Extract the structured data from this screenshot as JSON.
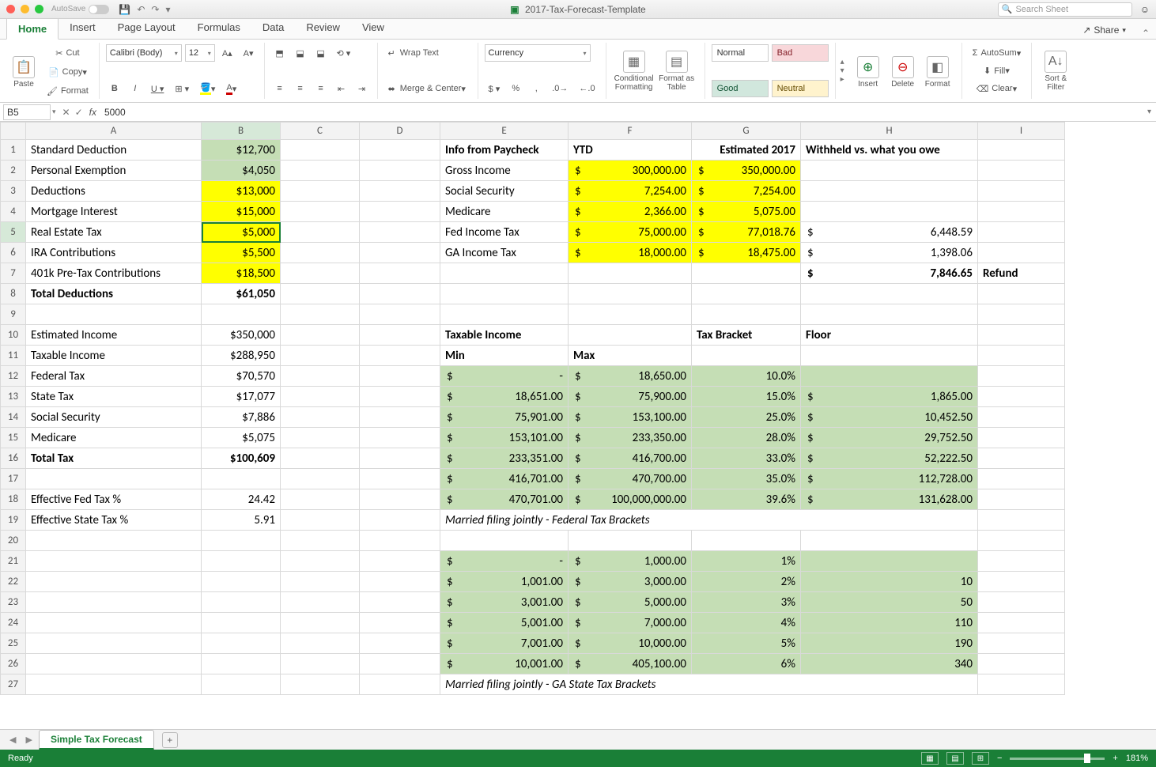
{
  "app": {
    "title": "2017-Tax-Forecast-Template",
    "search_placeholder": "Search Sheet",
    "autosave": "AutoSave"
  },
  "tabs": [
    "Home",
    "Insert",
    "Page Layout",
    "Formulas",
    "Data",
    "Review",
    "View"
  ],
  "share": "Share",
  "ribbon": {
    "paste": "Paste",
    "cut": "Cut",
    "copy": "Copy",
    "format": "Format",
    "font": "Calibri (Body)",
    "size": "12",
    "wrap": "Wrap Text",
    "merge": "Merge & Center",
    "numfmt": "Currency",
    "cond": "Conditional Formatting",
    "table": "Format as Table",
    "styles": {
      "normal": "Normal",
      "bad": "Bad",
      "good": "Good",
      "neutral": "Neutral"
    },
    "insert": "Insert",
    "delete": "Delete",
    "formatcell": "Format",
    "autosum": "AutoSum",
    "fill": "Fill",
    "clear": "Clear",
    "sort": "Sort & Filter"
  },
  "namebox": "B5",
  "formula": "5000",
  "cols": [
    "A",
    "B",
    "C",
    "D",
    "E",
    "F",
    "G",
    "H",
    "I"
  ],
  "rows": [
    {
      "n": 1,
      "A": "Standard Deduction",
      "B": "$12,700",
      "Bcls": "hlGreen r",
      "E": "Info from Paycheck",
      "Ecls": "b",
      "F": "YTD",
      "Fcls": "b l",
      "G": "Estimated 2017",
      "Gcls": "b r",
      "H": "Withheld vs. what you owe",
      "Hcls": "b l"
    },
    {
      "n": 2,
      "A": "Personal Exemption",
      "B": "$4,050",
      "Bcls": "hlGreen r",
      "E": "Gross Income",
      "F": {
        "sym": "$",
        "val": "300,000.00"
      },
      "Fcls": "hlYellow",
      "G": {
        "sym": "$",
        "val": "350,000.00"
      },
      "Gcls": "hlYellow"
    },
    {
      "n": 3,
      "A": "Deductions",
      "B": "$13,000",
      "Bcls": "hlYellow r",
      "E": "Social Security",
      "F": {
        "sym": "$",
        "val": "7,254.00"
      },
      "Fcls": "hlYellow",
      "G": {
        "sym": "$",
        "val": "7,254.00"
      },
      "Gcls": "hlYellow"
    },
    {
      "n": 4,
      "A": "Mortgage Interest",
      "B": "$15,000",
      "Bcls": "hlYellow r",
      "E": "Medicare",
      "F": {
        "sym": "$",
        "val": "2,366.00"
      },
      "Fcls": "hlYellow",
      "G": {
        "sym": "$",
        "val": "5,075.00"
      },
      "Gcls": "hlYellow"
    },
    {
      "n": 5,
      "A": "Real Estate Tax",
      "B": "$5,000",
      "Bcls": "hlYellow r activecell",
      "E": "Fed Income Tax",
      "F": {
        "sym": "$",
        "val": "75,000.00"
      },
      "Fcls": "hlYellow",
      "G": {
        "sym": "$",
        "val": "77,018.76"
      },
      "Gcls": "hlYellow",
      "H": {
        "sym": "$",
        "val": "6,448.59"
      }
    },
    {
      "n": 6,
      "A": "IRA Contributions",
      "B": "$5,500",
      "Bcls": "hlYellow r",
      "E": "GA Income Tax",
      "F": {
        "sym": "$",
        "val": "18,000.00"
      },
      "Fcls": "hlYellow",
      "G": {
        "sym": "$",
        "val": "18,475.00"
      },
      "Gcls": "hlYellow",
      "H": {
        "sym": "$",
        "val": "1,398.06"
      }
    },
    {
      "n": 7,
      "A": "401k Pre-Tax Contributions",
      "B": "$18,500",
      "Bcls": "hlYellow r",
      "H": {
        "sym": "$",
        "val": "7,846.65"
      },
      "Hcls": "b",
      "I": "Refund",
      "Icls": "b l"
    },
    {
      "n": 8,
      "A": "Total Deductions",
      "Acls": "b",
      "B": "$61,050",
      "Bcls": "b r"
    },
    {
      "n": 9
    },
    {
      "n": 10,
      "A": "Estimated Income",
      "B": "$350,000",
      "Bcls": "r",
      "E": "Taxable Income",
      "Ecls": "b",
      "G": "Tax Bracket",
      "Gcls": "b l",
      "H": "Floor",
      "Hcls": "b l"
    },
    {
      "n": 11,
      "A": "Taxable Income",
      "B": "$288,950",
      "Bcls": "r",
      "E": "Min",
      "Ecls": "b",
      "F": "Max",
      "Fcls": "b l"
    },
    {
      "n": 12,
      "A": "Federal Tax",
      "B": "$70,570",
      "Bcls": "r",
      "E": {
        "sym": "$",
        "val": "-"
      },
      "Ecls": "hlSage",
      "F": {
        "sym": "$",
        "val": "18,650.00"
      },
      "Fcls": "hlSage",
      "G": "10.0%",
      "Gcls": "hlSage r",
      "Hcls": "hlSage"
    },
    {
      "n": 13,
      "A": "State Tax",
      "B": "$17,077",
      "Bcls": "r",
      "E": {
        "sym": "$",
        "val": "18,651.00"
      },
      "Ecls": "hlSage",
      "F": {
        "sym": "$",
        "val": "75,900.00"
      },
      "Fcls": "hlSage",
      "G": "15.0%",
      "Gcls": "hlSage r",
      "H": {
        "sym": "$",
        "val": "1,865.00"
      },
      "Hcls": "hlSage"
    },
    {
      "n": 14,
      "A": "Social Security",
      "B": "$7,886",
      "Bcls": "r",
      "E": {
        "sym": "$",
        "val": "75,901.00"
      },
      "Ecls": "hlSage",
      "F": {
        "sym": "$",
        "val": "153,100.00"
      },
      "Fcls": "hlSage",
      "G": "25.0%",
      "Gcls": "hlSage r",
      "H": {
        "sym": "$",
        "val": "10,452.50"
      },
      "Hcls": "hlSage"
    },
    {
      "n": 15,
      "A": "Medicare",
      "B": "$5,075",
      "Bcls": "r",
      "E": {
        "sym": "$",
        "val": "153,101.00"
      },
      "Ecls": "hlSage",
      "F": {
        "sym": "$",
        "val": "233,350.00"
      },
      "Fcls": "hlSage",
      "G": "28.0%",
      "Gcls": "hlSage r",
      "H": {
        "sym": "$",
        "val": "29,752.50"
      },
      "Hcls": "hlSage"
    },
    {
      "n": 16,
      "A": "Total Tax",
      "Acls": "b",
      "B": "$100,609",
      "Bcls": "b r",
      "E": {
        "sym": "$",
        "val": "233,351.00"
      },
      "Ecls": "hlSage",
      "F": {
        "sym": "$",
        "val": "416,700.00"
      },
      "Fcls": "hlSage",
      "G": "33.0%",
      "Gcls": "hlSage r",
      "H": {
        "sym": "$",
        "val": "52,222.50"
      },
      "Hcls": "hlSage"
    },
    {
      "n": 17,
      "E": {
        "sym": "$",
        "val": "416,701.00"
      },
      "Ecls": "hlSage",
      "F": {
        "sym": "$",
        "val": "470,700.00"
      },
      "Fcls": "hlSage",
      "G": "35.0%",
      "Gcls": "hlSage r",
      "H": {
        "sym": "$",
        "val": "112,728.00"
      },
      "Hcls": "hlSage"
    },
    {
      "n": 18,
      "A": "Effective Fed Tax %",
      "B": "24.42",
      "Bcls": "r",
      "E": {
        "sym": "$",
        "val": "470,701.00"
      },
      "Ecls": "hlSage",
      "F": {
        "sym": "$",
        "val": "100,000,000.00"
      },
      "Fcls": "hlSage",
      "G": "39.6%",
      "Gcls": "hlSage r",
      "H": {
        "sym": "$",
        "val": "131,628.00"
      },
      "Hcls": "hlSage"
    },
    {
      "n": 19,
      "A": "Effective State Tax %",
      "B": "5.91",
      "Bcls": "r",
      "E": "Married filing jointly - Federal Tax Brackets",
      "Ecls": "i",
      "Espan": 4
    },
    {
      "n": 20
    },
    {
      "n": 21,
      "E": {
        "sym": "$",
        "val": "-"
      },
      "Ecls": "hlSage",
      "F": {
        "sym": "$",
        "val": "1,000.00"
      },
      "Fcls": "hlSage",
      "G": "1%",
      "Gcls": "hlSage r",
      "Hcls": "hlSage"
    },
    {
      "n": 22,
      "E": {
        "sym": "$",
        "val": "1,001.00"
      },
      "Ecls": "hlSage",
      "F": {
        "sym": "$",
        "val": "3,000.00"
      },
      "Fcls": "hlSage",
      "G": "2%",
      "Gcls": "hlSage r",
      "H": "10",
      "Hcls": "hlSage r"
    },
    {
      "n": 23,
      "E": {
        "sym": "$",
        "val": "3,001.00"
      },
      "Ecls": "hlSage",
      "F": {
        "sym": "$",
        "val": "5,000.00"
      },
      "Fcls": "hlSage",
      "G": "3%",
      "Gcls": "hlSage r",
      "H": "50",
      "Hcls": "hlSage r"
    },
    {
      "n": 24,
      "E": {
        "sym": "$",
        "val": "5,001.00"
      },
      "Ecls": "hlSage",
      "F": {
        "sym": "$",
        "val": "7,000.00"
      },
      "Fcls": "hlSage",
      "G": "4%",
      "Gcls": "hlSage r",
      "H": "110",
      "Hcls": "hlSage r"
    },
    {
      "n": 25,
      "E": {
        "sym": "$",
        "val": "7,001.00"
      },
      "Ecls": "hlSage",
      "F": {
        "sym": "$",
        "val": "10,000.00"
      },
      "Fcls": "hlSage",
      "G": "5%",
      "Gcls": "hlSage r",
      "H": "190",
      "Hcls": "hlSage r"
    },
    {
      "n": 26,
      "E": {
        "sym": "$",
        "val": "10,001.00"
      },
      "Ecls": "hlSage",
      "F": {
        "sym": "$",
        "val": "405,100.00"
      },
      "Fcls": "hlSage",
      "G": "6%",
      "Gcls": "hlSage r",
      "H": "340",
      "Hcls": "hlSage r"
    },
    {
      "n": 27,
      "E": "Married filing jointly - GA State Tax Brackets",
      "Ecls": "i",
      "Espan": 4
    }
  ],
  "sheet": "Simple Tax Forecast",
  "status": {
    "ready": "Ready",
    "zoom": "181%"
  }
}
